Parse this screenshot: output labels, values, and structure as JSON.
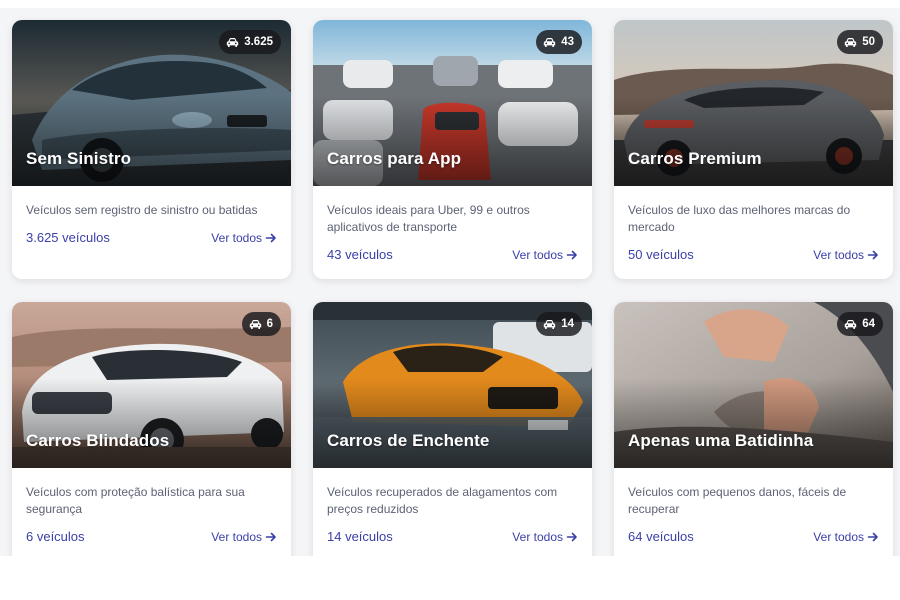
{
  "cards": [
    {
      "title": "Sem Sinistro",
      "badge_count": "3.625",
      "description": "Veículos sem registro de sinistro ou batidas",
      "count_label": "3.625 veículos",
      "link_label": "Ver todos",
      "image_subject": "grey sports coupe at sunset"
    },
    {
      "title": "Carros para App",
      "badge_count": "43",
      "description": "Veículos ideais para Uber, 99 e outros aplicativos de transporte",
      "count_label": "43 veículos",
      "link_label": "Ver todos",
      "image_subject": "parking lot with many compact cars"
    },
    {
      "title": "Carros Premium",
      "badge_count": "50",
      "description": "Veículos de luxo das melhores marcas do mercado",
      "count_label": "50 veículos",
      "link_label": "Ver todos",
      "image_subject": "grey supercar on a mountain road"
    },
    {
      "title": "Carros Blindados",
      "badge_count": "6",
      "description": "Veículos com proteção balística para sua segurança",
      "count_label": "6 veículos",
      "link_label": "Ver todos",
      "image_subject": "white SUV in the desert"
    },
    {
      "title": "Carros de Enchente",
      "badge_count": "14",
      "description": "Veículos recuperados de alagamentos com preços reduzidos",
      "count_label": "14 veículos",
      "link_label": "Ver todos",
      "image_subject": "orange sports car in flood water"
    },
    {
      "title": "Apenas uma Batidinha",
      "badge_count": "64",
      "description": "Veículos com pequenos danos, fáceis de recuperar",
      "count_label": "64 veículos",
      "link_label": "Ver todos",
      "image_subject": "hands touching a dented car body"
    }
  ],
  "colors": {
    "accent": "#3a3fa8",
    "text_muted": "#5d6275",
    "badge_bg": "#19191c",
    "card_bg": "#ffffff",
    "page_bg": "#f4f5f7"
  },
  "icons": {
    "badge": "car-icon",
    "link": "arrow-right-icon"
  }
}
